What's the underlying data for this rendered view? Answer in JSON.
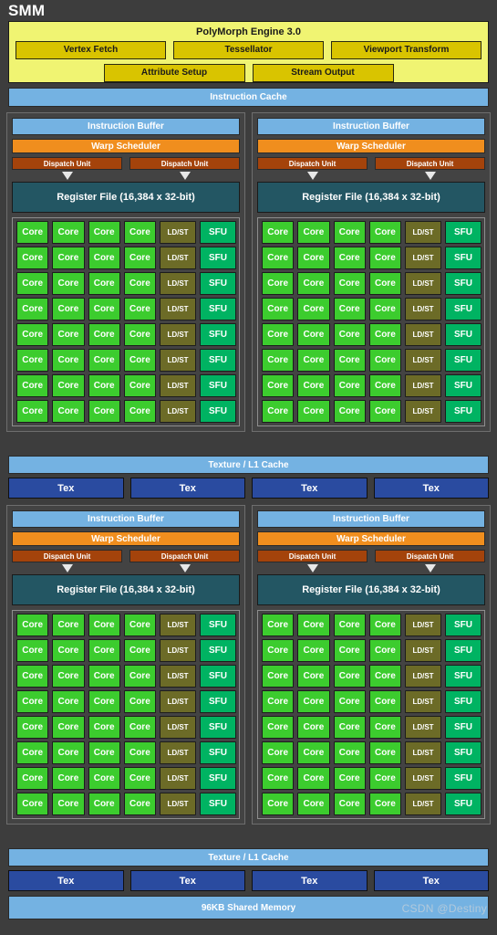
{
  "title": "SMM",
  "colors": {
    "background": "#3d3d3d",
    "polymorph_fill": "#f0f472",
    "polymorph_button": "#d9c400",
    "cache_blue": "#74b2e2",
    "warp_orange": "#f08e1e",
    "dispatch_brown": "#a4430b",
    "regfile_teal": "#235663",
    "core_green": "#3ccc2e",
    "ldst_olive": "#6c6b27",
    "sfu_green": "#00b362",
    "tex_blue": "#2a4ba0"
  },
  "polymorph": {
    "title": "PolyMorph Engine 3.0",
    "row1": [
      "Vertex Fetch",
      "Tessellator",
      "Viewport Transform"
    ],
    "row2": [
      "Attribute Setup",
      "Stream Output"
    ]
  },
  "instruction_cache": "Instruction Cache",
  "processing_block": {
    "instruction_buffer": "Instruction Buffer",
    "warp_scheduler": "Warp Scheduler",
    "dispatch_unit": "Dispatch Unit",
    "dispatch_unit_count": 2,
    "register_file": "Register File (16,384 x 32-bit)",
    "core_label": "Core",
    "ldst_label": "LD/ST",
    "sfu_label": "SFU",
    "core_rows": 8,
    "cores_per_row": 4,
    "ldst_per_row": 1,
    "sfu_per_row": 1,
    "total_cores": 32,
    "count": 4
  },
  "texture_section": {
    "cache_label": "Texture / L1 Cache",
    "tex_label": "Tex",
    "tex_count": 4
  },
  "shared_memory": "96KB Shared Memory",
  "watermark": "CSDN @Destiny"
}
